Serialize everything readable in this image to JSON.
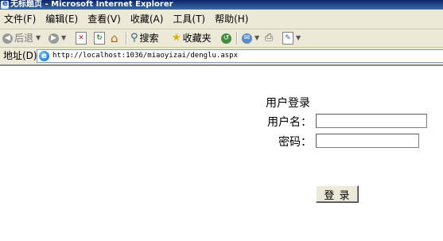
{
  "window": {
    "title": "无标题页 - Microsoft Internet Explorer"
  },
  "menubar": {
    "items": [
      "文件(F)",
      "编辑(E)",
      "查看(V)",
      "收藏(A)",
      "工具(T)",
      "帮助(H)"
    ]
  },
  "toolbar": {
    "back_label": "后退",
    "search_label": "搜索",
    "favorites_label": "收藏夹",
    "icons": [
      "back-arrow",
      "forward-arrow",
      "stop",
      "refresh",
      "home",
      "search",
      "favorites-star",
      "history",
      "mail",
      "print",
      "edit"
    ]
  },
  "addressbar": {
    "label": "地址(D)",
    "url": "http://localhost:1036/miaoyizai/denglu.aspx"
  },
  "login_form": {
    "heading": "用户登录",
    "username_label": "用户名：",
    "username_value": "",
    "password_label": "密码：",
    "password_value": "",
    "submit_label": "登 录"
  }
}
